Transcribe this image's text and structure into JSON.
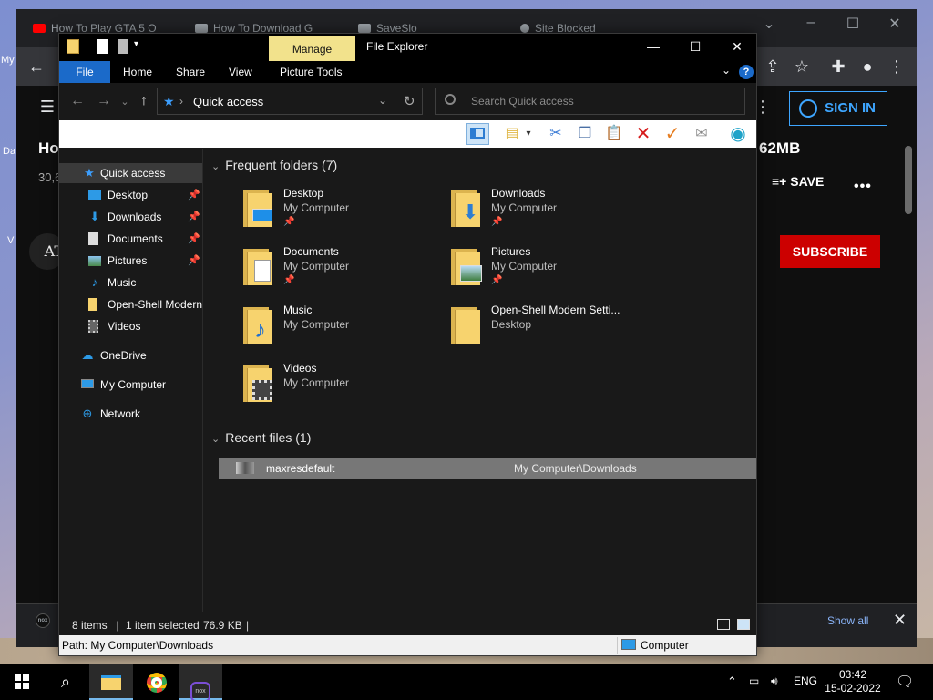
{
  "browser": {
    "tabs": [
      {
        "label": "How To Play GTA 5 O"
      },
      {
        "label": "How To Download G"
      },
      {
        "label": "SaveSlo"
      },
      {
        "label": "Site Blocked"
      }
    ],
    "sign_in": "SIGN IN",
    "title_left": "Ho",
    "title_right": "62MB",
    "views_fragment": "30,6",
    "save_label": "SAVE",
    "subscribe_label": "SUBSCRIBE",
    "channel_fragment": "AT",
    "show_all": "Show all",
    "side_fragment_1": "My",
    "side_fragment_2": "Da",
    "side_fragment_3": "V"
  },
  "explorer": {
    "manage_tab": "Manage",
    "title": "File Explorer",
    "ribbon_tabs": [
      "File",
      "Home",
      "Share",
      "View",
      "Picture Tools"
    ],
    "address": "Quick access",
    "search_placeholder": "Search Quick access",
    "nav": [
      {
        "label": "Quick access",
        "icon": "star-icon"
      },
      {
        "label": "Desktop",
        "icon": "desktop-icon",
        "pinned": true
      },
      {
        "label": "Downloads",
        "icon": "download-icon",
        "pinned": true
      },
      {
        "label": "Documents",
        "icon": "document-icon",
        "pinned": true
      },
      {
        "label": "Pictures",
        "icon": "pictures-icon",
        "pinned": true
      },
      {
        "label": "Music",
        "icon": "music-icon"
      },
      {
        "label": "Open-Shell Modern",
        "icon": "folder-icon"
      },
      {
        "label": "Videos",
        "icon": "videos-icon"
      },
      {
        "label": "OneDrive",
        "icon": "cloud-icon"
      },
      {
        "label": "My Computer",
        "icon": "computer-icon"
      },
      {
        "label": "Network",
        "icon": "network-icon"
      }
    ],
    "frequent_header": "Frequent folders (7)",
    "frequent": [
      {
        "name": "Desktop",
        "location": "My Computer",
        "pinned": true
      },
      {
        "name": "Downloads",
        "location": "My Computer",
        "pinned": true
      },
      {
        "name": "Documents",
        "location": "My Computer",
        "pinned": true
      },
      {
        "name": "Pictures",
        "location": "My Computer",
        "pinned": true
      },
      {
        "name": "Music",
        "location": "My Computer",
        "pinned": false
      },
      {
        "name": "Open-Shell Modern Setti...",
        "location": "Desktop",
        "pinned": false
      },
      {
        "name": "Videos",
        "location": "My Computer",
        "pinned": false
      }
    ],
    "recent_header": "Recent files (1)",
    "recent": [
      {
        "name": "maxresdefault",
        "path": "My Computer\\Downloads"
      }
    ],
    "status": {
      "items": "8 items",
      "selected": "1 item selected",
      "size": "76.9 KB"
    },
    "pathbar": {
      "path": "Path: My Computer\\Downloads",
      "location": "Computer"
    }
  },
  "taskbar": {
    "language": "ENG",
    "time": "03:42",
    "date": "15-02-2022"
  },
  "colors": {
    "accent": "#1b6ac9",
    "manage_tab": "#f2e28c",
    "subscribe": "#cc0000",
    "folder": "#f7d36e"
  }
}
